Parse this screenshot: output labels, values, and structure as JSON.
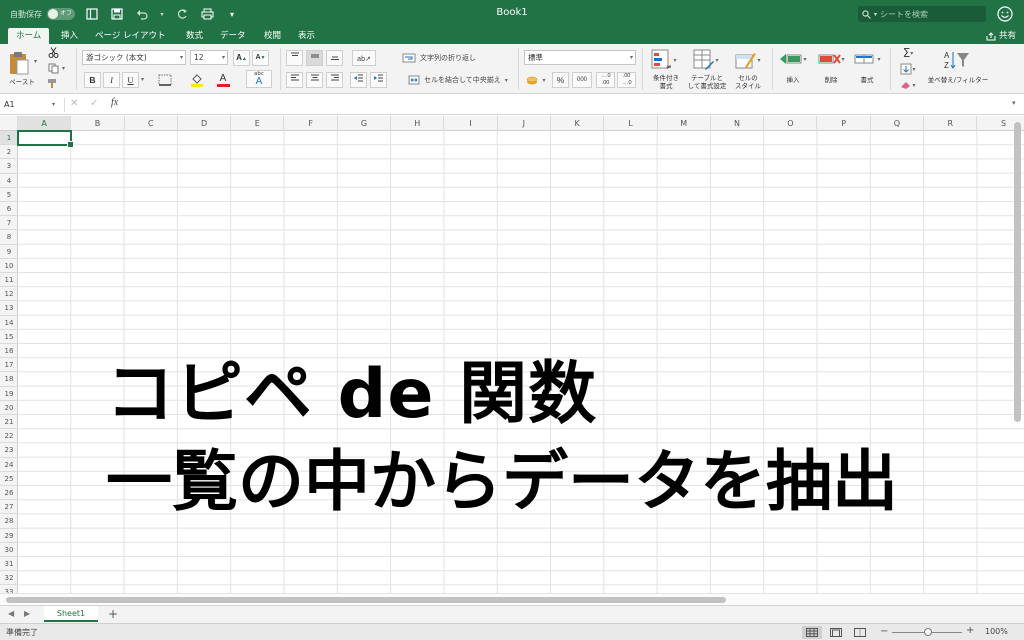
{
  "colors": {
    "accent": "#217346",
    "ribbon_bg": "#f3f3f3",
    "grid_line": "#e2e2e2"
  },
  "titlebar": {
    "autosave_label": "自動保存",
    "autosave_state": "オフ",
    "title": "Book1",
    "search_placeholder": "シートを検索"
  },
  "tabs": [
    "ホーム",
    "挿入",
    "ページ レイアウト",
    "数式",
    "データ",
    "校閲",
    "表示"
  ],
  "share_label": "共有",
  "ribbon": {
    "paste_label": "ペースト",
    "font_name": "游ゴシック (本文)",
    "font_size": "12",
    "wrap_text": "文字列の折り返し",
    "merge_center": "セルを結合して中央揃え",
    "number_format": "標準",
    "percent": "%",
    "comma": "000",
    "cond_format": [
      "条件付き",
      "書式"
    ],
    "table_format": [
      "テーブルと",
      "して書式設定"
    ],
    "cell_style": [
      "セルの",
      "スタイル"
    ],
    "insert": "挿入",
    "delete": "削除",
    "format": "書式",
    "sort_filter": "並べ替え/フィルター",
    "bold": "B",
    "italic": "I",
    "underline": "U"
  },
  "formula_bar": {
    "name_box": "A1",
    "fx": "fx",
    "content": ""
  },
  "grid": {
    "columns": [
      "A",
      "B",
      "C",
      "D",
      "E",
      "F",
      "G",
      "H",
      "I",
      "J",
      "K",
      "L",
      "M",
      "N",
      "O",
      "P",
      "Q",
      "R",
      "S"
    ],
    "row_count": 33,
    "active_cell": "A1"
  },
  "overlay": {
    "line1": "コピペ de 関数",
    "line2": "一覧の中からデータを抽出"
  },
  "sheets": [
    "Sheet1"
  ],
  "status": {
    "text": "準備完了",
    "zoom": "100%"
  }
}
